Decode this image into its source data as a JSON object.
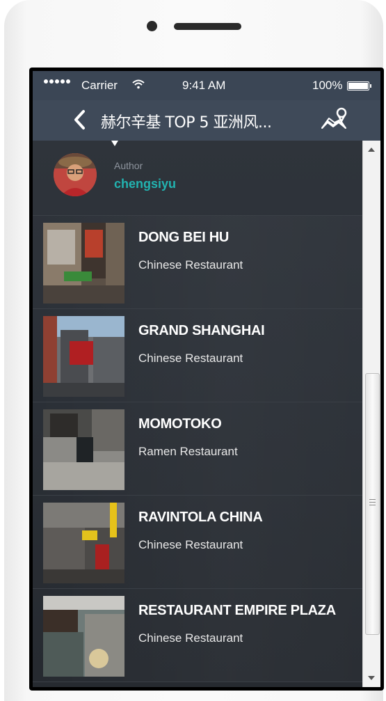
{
  "status_bar": {
    "carrier": "Carrier",
    "time": "9:41 AM",
    "battery": "100%",
    "signal_dots": 5,
    "wifi_icon": "wifi-icon",
    "battery_icon": "battery-icon"
  },
  "nav": {
    "title": "赫尔辛基 TOP 5 亚洲风...",
    "back_icon": "chevron-left-icon",
    "map_icon": "map-pin-icon"
  },
  "author": {
    "label": "Author",
    "name": "chengsiyu"
  },
  "places": [
    {
      "name": "DONG BEI HU",
      "type": "Chinese Restaurant"
    },
    {
      "name": "GRAND SHANGHAI",
      "type": "Chinese Restaurant"
    },
    {
      "name": "MOMOTOKO",
      "type": "Ramen Restaurant"
    },
    {
      "name": "RAVINTOLA CHINA",
      "type": "Chinese Restaurant"
    },
    {
      "name": "RESTAURANT EMPIRE PLAZA",
      "type": "Chinese Restaurant"
    }
  ],
  "colors": {
    "status_bar": "#3b4655",
    "nav_bar": "#3f4a59",
    "content_bg": "#2c3036",
    "author_name": "#22b3b0",
    "scrollbar": "#f2f2f2"
  }
}
